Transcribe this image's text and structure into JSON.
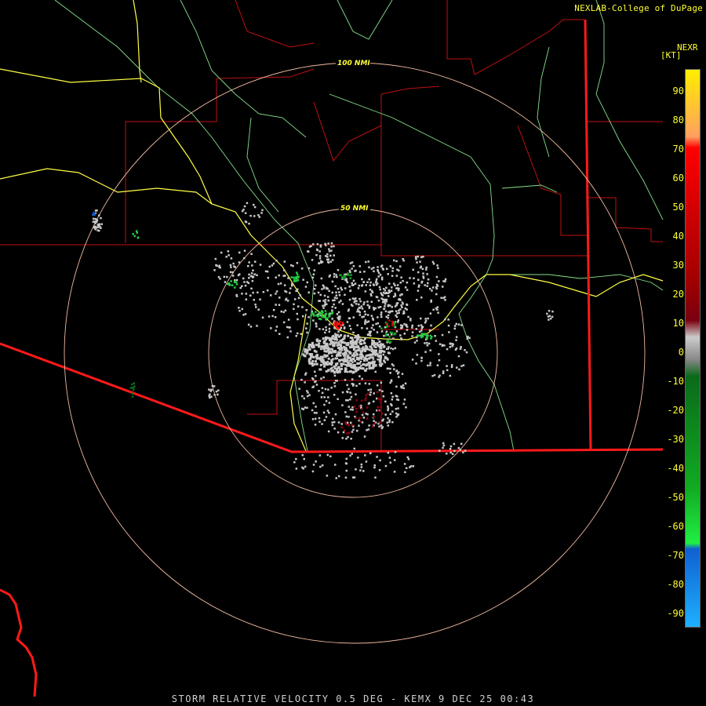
{
  "credit": "NEXLAB-College of DuPage",
  "product": "NEXR",
  "unit": "[KT]",
  "caption": "STORM RELATIVE VELOCITY 0.5 DEG - KEMX 9 DEC 25 00:43",
  "range_rings": [
    {
      "label": "100 NMI",
      "nmi": 100
    },
    {
      "label": "50 NMI",
      "nmi": 50
    }
  ],
  "legend": {
    "ticks": [
      "90",
      "80",
      "70",
      "60",
      "50",
      "40",
      "30",
      "20",
      "10",
      "0",
      "-10",
      "-20",
      "-30",
      "-40",
      "-50",
      "-60",
      "-70",
      "-80",
      "-90"
    ],
    "colors": {
      "strong_inbound": "#1fb0ff",
      "inbound_light": "#1060d0",
      "inbound_green_bright": "#22ee44",
      "inbound_green_dark": "#0b6a1a",
      "near_zero": "#cccccc",
      "outbound_dark": "#7a0010",
      "outbound_red": "#ff0000",
      "outbound_orange": "#ffa060",
      "strong_outbound": "#ffee00"
    }
  },
  "map_colors": {
    "county_lines": "#c01010",
    "rivers": "#86e08a",
    "highways": "#ffff44",
    "borders": "#ff1a1a",
    "range_rings": "#f0b9a0"
  }
}
